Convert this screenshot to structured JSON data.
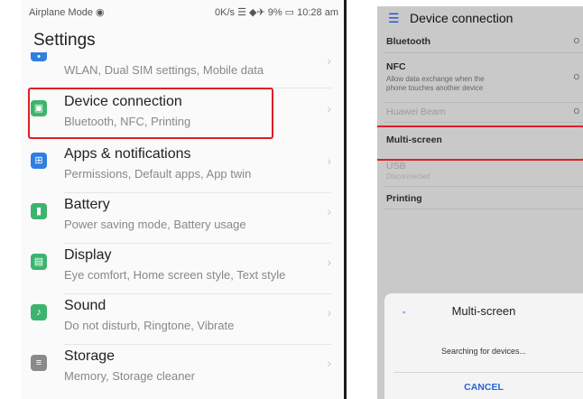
{
  "left_phone": {
    "status_bar": {
      "left": "Airplane Mode ◉",
      "right": "0K/s ☰ ◆✈ 9% ▭ 10:28 am"
    },
    "title": "Settings",
    "items": [
      {
        "title": "",
        "subtitle": "WLAN, Dual SIM settings, Mobile data",
        "icon": "wlan-icon",
        "icon_color": "#2f7fe0"
      },
      {
        "title": "Device connection",
        "subtitle": "Bluetooth, NFC, Printing",
        "icon": "device-connection-icon",
        "icon_color": "#3db46d"
      },
      {
        "title": "Apps & notifications",
        "subtitle": "Permissions, Default apps, App twin",
        "icon": "apps-icon",
        "icon_color": "#2f7fe0"
      },
      {
        "title": "Battery",
        "subtitle": "Power saving mode, Battery usage",
        "icon": "battery-icon",
        "icon_color": "#3db46d"
      },
      {
        "title": "Display",
        "subtitle": "Eye comfort, Home screen style, Text style",
        "icon": "display-icon",
        "icon_color": "#3db46d"
      },
      {
        "title": "Sound",
        "subtitle": "Do not disturb, Ringtone, Vibrate",
        "icon": "sound-icon",
        "icon_color": "#3db46d"
      },
      {
        "title": "Storage",
        "subtitle": "Memory, Storage cleaner",
        "icon": "storage-icon",
        "icon_color": "#8a8a8a"
      }
    ],
    "highlight_color": "#e01e26"
  },
  "right_phone": {
    "header_title": "Device connection",
    "rows": [
      {
        "title": "Bluetooth",
        "subtitle": "",
        "value": "O"
      },
      {
        "title": "NFC",
        "subtitle_1": "Allow data exchange when the",
        "subtitle_2": "phone touches another device",
        "value": "O"
      },
      {
        "title": "Huawei Beam",
        "subtitle": "",
        "value": "O"
      },
      {
        "title": "Multi-screen",
        "subtitle": "",
        "value": ""
      },
      {
        "title": "USB",
        "subtitle": "Disconnected",
        "value": ""
      },
      {
        "title": "Printing",
        "subtitle": "",
        "value": ""
      }
    ],
    "sheet": {
      "title": "Multi-screen",
      "message": "Searching for devices...",
      "cancel": "CANCEL"
    },
    "accent": "#1e4fd6"
  }
}
